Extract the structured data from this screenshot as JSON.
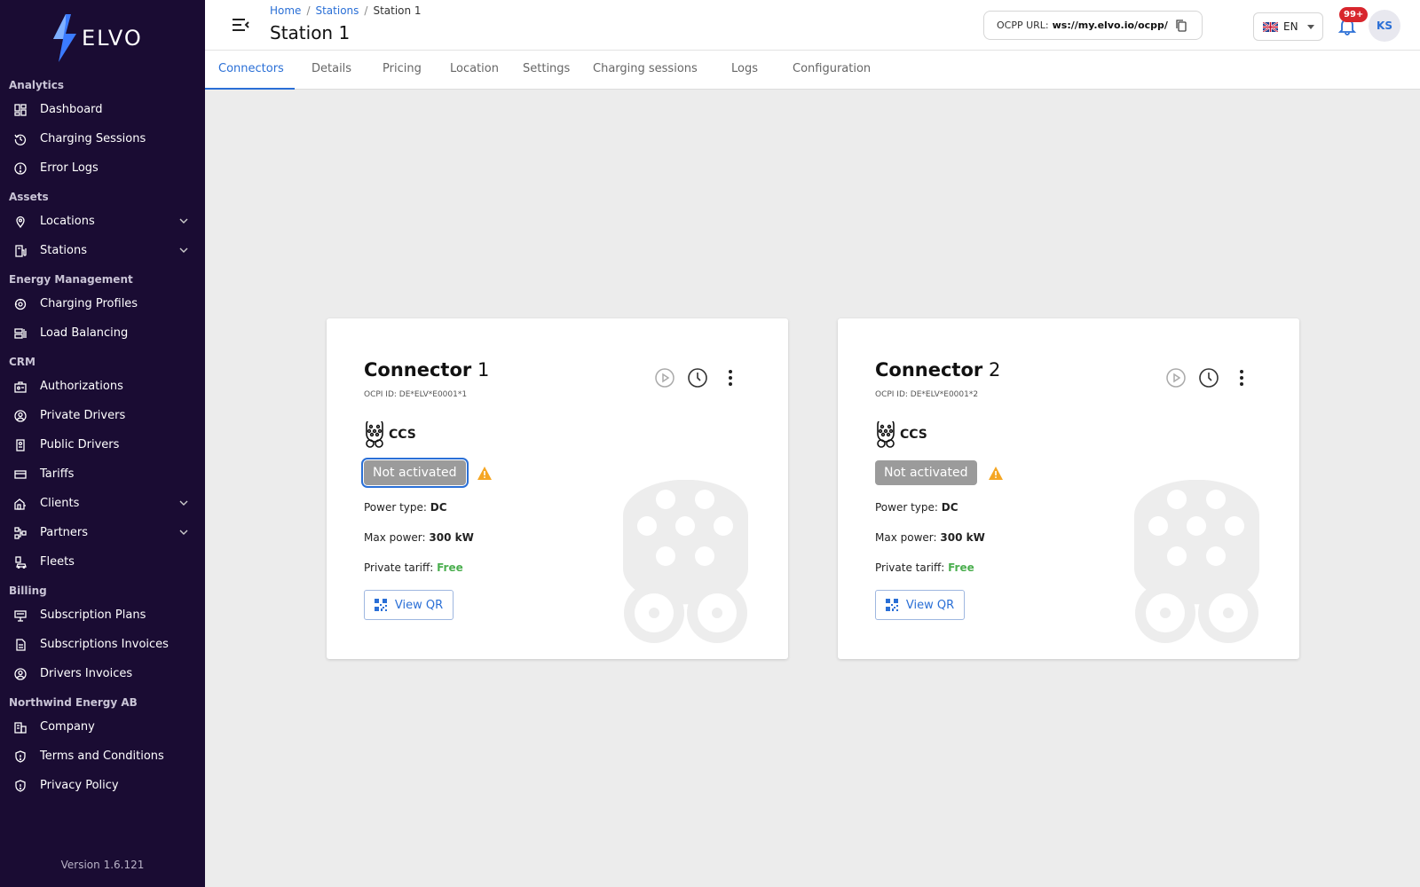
{
  "brand": {
    "name": "ELVO",
    "version": "Version 1.6.121"
  },
  "sidebar": {
    "sections": [
      {
        "title": "Analytics",
        "items": [
          {
            "label": "Dashboard",
            "icon": "dashboard-icon"
          },
          {
            "label": "Charging Sessions",
            "icon": "history-icon"
          },
          {
            "label": "Error Logs",
            "icon": "alert-circle-icon"
          }
        ]
      },
      {
        "title": "Assets",
        "items": [
          {
            "label": "Locations",
            "icon": "location-pin-icon",
            "expandable": true
          },
          {
            "label": "Stations",
            "icon": "station-icon",
            "expandable": true
          }
        ]
      },
      {
        "title": "Energy Management",
        "items": [
          {
            "label": "Charging Profiles",
            "icon": "profile-gauge-icon"
          },
          {
            "label": "Load Balancing",
            "icon": "load-balancing-icon"
          }
        ]
      },
      {
        "title": "CRM",
        "items": [
          {
            "label": "Authorizations",
            "icon": "authorization-icon"
          },
          {
            "label": "Private Drivers",
            "icon": "user-circle-icon"
          },
          {
            "label": "Public Drivers",
            "icon": "badge-icon"
          },
          {
            "label": "Tariffs",
            "icon": "credit-card-icon"
          },
          {
            "label": "Clients",
            "icon": "clients-icon",
            "expandable": true
          },
          {
            "label": "Partners",
            "icon": "partners-icon",
            "expandable": true
          },
          {
            "label": "Fleets",
            "icon": "fleet-icon"
          }
        ]
      },
      {
        "title": "Billing",
        "items": [
          {
            "label": "Subscription Plans",
            "icon": "plans-icon"
          },
          {
            "label": "Subscriptions Invoices",
            "icon": "invoice-icon"
          },
          {
            "label": "Drivers Invoices",
            "icon": "user-circle-icon"
          }
        ]
      },
      {
        "title": "Northwind Energy AB",
        "items": [
          {
            "label": "Company",
            "icon": "company-icon"
          },
          {
            "label": "Terms and Conditions",
            "icon": "shield-icon"
          },
          {
            "label": "Privacy Policy",
            "icon": "shield-icon"
          }
        ]
      }
    ]
  },
  "header": {
    "breadcrumb": [
      "Home",
      "Stations",
      "Station 1"
    ],
    "title": "Station 1",
    "ocpp_label": "OCPP URL:",
    "ocpp_url": "ws://my.elvo.io/ocpp/",
    "language": "EN",
    "notifications_badge": "99+",
    "avatar_initials": "KS"
  },
  "tabs": [
    "Connectors",
    "Details",
    "Pricing",
    "Location",
    "Settings",
    "Charging sessions",
    "Logs",
    "Configuration"
  ],
  "active_tab": "Connectors",
  "connectors": [
    {
      "title_word": "Connector",
      "number": "1",
      "ocpi_id": "OCPI ID: DE*ELV*E0001*1",
      "type": "CCS",
      "status": "Not activated",
      "power_type_label": "Power type:",
      "power_type": "DC",
      "max_power_label": "Max power:",
      "max_power": "300 kW",
      "tariff_label": "Private tariff:",
      "tariff": "Free",
      "qr_label": "View QR"
    },
    {
      "title_word": "Connector",
      "number": "2",
      "ocpi_id": "OCPI ID: DE*ELV*E0001*2",
      "type": "CCS",
      "status": "Not activated",
      "power_type_label": "Power type:",
      "power_type": "DC",
      "max_power_label": "Max power:",
      "max_power": "300 kW",
      "tariff_label": "Private tariff:",
      "tariff": "Free",
      "qr_label": "View QR"
    }
  ],
  "colors": {
    "sidebar_bg": "#1a0c33",
    "accent": "#2a6fd6",
    "free": "#4caf50",
    "badge": "#d8262d",
    "status_pill": "#9b9b9b"
  }
}
